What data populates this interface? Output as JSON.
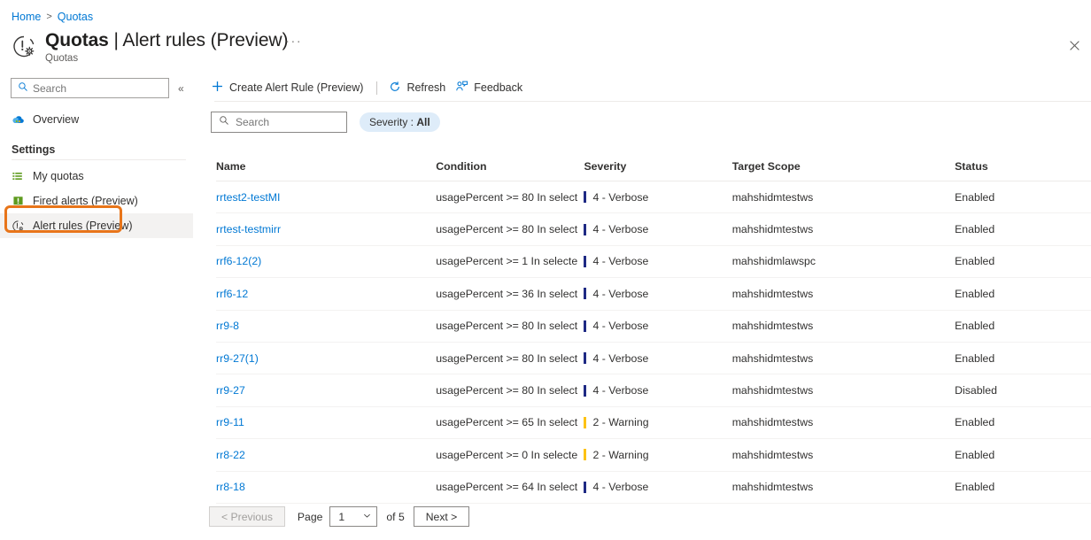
{
  "breadcrumb": {
    "home": "Home",
    "separator": ">",
    "current": "Quotas"
  },
  "header": {
    "title_main": "Quotas",
    "title_divider": " | ",
    "title_sub_page": "Alert rules (Preview)",
    "subtitle": "Quotas",
    "ellipsis": "···",
    "icon": "quota-alert-gear-icon",
    "close_icon": "close-icon"
  },
  "sidebar": {
    "search": {
      "placeholder": "Search",
      "value": "",
      "icon": "search-icon"
    },
    "collapse_icon": "double-chevron-left-icon",
    "overview": {
      "label": "Overview",
      "icon": "cloud-icon"
    },
    "section_label": "Settings",
    "items": [
      {
        "label": "My quotas",
        "icon": "list-icon",
        "selected": false
      },
      {
        "label": "Fired alerts (Preview)",
        "icon": "alert-bell-icon",
        "selected": false
      },
      {
        "label": "Alert rules (Preview)",
        "icon": "alert-rule-icon",
        "selected": true
      }
    ],
    "highlight_color": "#e8751a"
  },
  "toolbar": {
    "create_label": "Create Alert Rule (Preview)",
    "create_icon": "plus-icon",
    "refresh_label": "Refresh",
    "refresh_icon": "refresh-icon",
    "feedback_label": "Feedback",
    "feedback_icon": "feedback-person-icon"
  },
  "filters": {
    "search": {
      "placeholder": "Search",
      "value": "",
      "icon": "search-icon"
    },
    "severity_pill_label": "Severity : ",
    "severity_pill_value": "All"
  },
  "table": {
    "columns": [
      "Name",
      "Condition",
      "Severity",
      "Target Scope",
      "Status"
    ],
    "rows": [
      {
        "name": "rrtest2-testMI",
        "condition": "usagePercent >= 80 In select",
        "severity": "4 - Verbose",
        "severity_color": "#1f2a84",
        "scope": "mahshidmtestws",
        "status": "Enabled"
      },
      {
        "name": "rrtest-testmirr",
        "condition": "usagePercent >= 80 In select",
        "severity": "4 - Verbose",
        "severity_color": "#1f2a84",
        "scope": "mahshidmtestws",
        "status": "Enabled"
      },
      {
        "name": "rrf6-12(2)",
        "condition": "usagePercent >= 1 In selecte",
        "severity": "4 - Verbose",
        "severity_color": "#1f2a84",
        "scope": "mahshidmlawspc",
        "status": "Enabled"
      },
      {
        "name": "rrf6-12",
        "condition": "usagePercent >= 36 In select",
        "severity": "4 - Verbose",
        "severity_color": "#1f2a84",
        "scope": "mahshidmtestws",
        "status": "Enabled"
      },
      {
        "name": "rr9-8",
        "condition": "usagePercent >= 80 In select",
        "severity": "4 - Verbose",
        "severity_color": "#1f2a84",
        "scope": "mahshidmtestws",
        "status": "Enabled"
      },
      {
        "name": "rr9-27(1)",
        "condition": "usagePercent >= 80 In select",
        "severity": "4 - Verbose",
        "severity_color": "#1f2a84",
        "scope": "mahshidmtestws",
        "status": "Enabled"
      },
      {
        "name": "rr9-27",
        "condition": "usagePercent >= 80 In select",
        "severity": "4 - Verbose",
        "severity_color": "#1f2a84",
        "scope": "mahshidmtestws",
        "status": "Disabled"
      },
      {
        "name": "rr9-11",
        "condition": "usagePercent >= 65 In select",
        "severity": "2 - Warning",
        "severity_color": "#fdc214",
        "scope": "mahshidmtestws",
        "status": "Enabled"
      },
      {
        "name": "rr8-22",
        "condition": "usagePercent >= 0 In selecte",
        "severity": "2 - Warning",
        "severity_color": "#fdc214",
        "scope": "mahshidmtestws",
        "status": "Enabled"
      },
      {
        "name": "rr8-18",
        "condition": "usagePercent >= 64 In select",
        "severity": "4 - Verbose",
        "severity_color": "#1f2a84",
        "scope": "mahshidmtestws",
        "status": "Enabled"
      }
    ]
  },
  "pagination": {
    "previous_label": "< Previous",
    "page_label": "Page",
    "current_page": "1",
    "of_label": "of 5",
    "next_label": "Next >",
    "chevron_icon": "chevron-down-icon"
  }
}
